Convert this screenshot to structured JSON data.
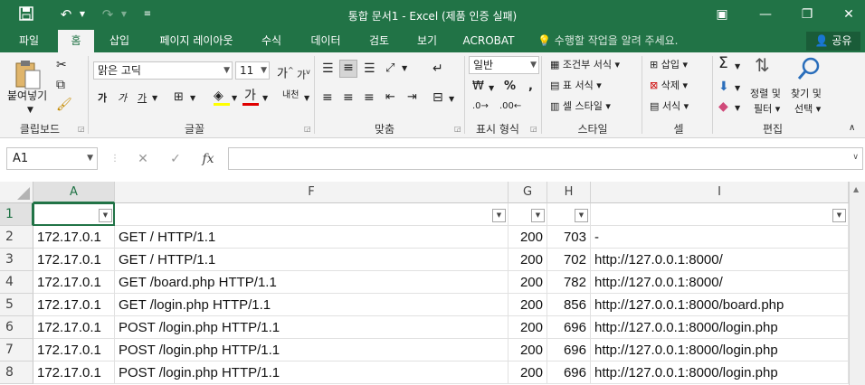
{
  "titlebar": {
    "title": "통합 문서1 - Excel (제품 인증 실패)",
    "icons": [
      "save-icon",
      "undo-icon",
      "redo-icon",
      "customize-icon"
    ]
  },
  "tabs": [
    "파일",
    "홈",
    "삽입",
    "페이지 레이아웃",
    "수식",
    "데이터",
    "검토",
    "보기",
    "ACROBAT"
  ],
  "tellme": "수행할 작업을 알려 주세요.",
  "share": "공유",
  "ribbon": {
    "clipboard": {
      "paste": "붙여넣기",
      "label": "클립보드"
    },
    "font": {
      "name": "맑은 고딕",
      "size": "11",
      "bold": "가",
      "italic": "가",
      "underline": "가",
      "fontcolor": "가",
      "phonetic": "내천",
      "grow": "가",
      "shrink": "가",
      "label": "글꼴"
    },
    "alignment": {
      "label": "맞춤"
    },
    "number": {
      "format": "일반",
      "label": "표시 형식"
    },
    "styles": {
      "conditional": "조건부 서식",
      "table": "표 서식",
      "cell": "셀 스타일",
      "label": "스타일"
    },
    "cells": {
      "insert": "삽입",
      "delete": "삭제",
      "format": "서식",
      "label": "셀"
    },
    "editing": {
      "sort1": "정렬 및",
      "sort2": "필터",
      "find1": "찾기 및",
      "find2": "선택",
      "label": "편집"
    }
  },
  "formula": {
    "namebox": "A1",
    "fx": "fx",
    "content": ""
  },
  "columns": [
    {
      "key": "A",
      "label": "A"
    },
    {
      "key": "F",
      "label": "F"
    },
    {
      "key": "G",
      "label": "G"
    },
    {
      "key": "H",
      "label": "H"
    },
    {
      "key": "I",
      "label": "I"
    }
  ],
  "rows": [
    {
      "num": "1",
      "a": "",
      "f": "",
      "g": "",
      "h": "",
      "i": ""
    },
    {
      "num": "2",
      "a": "172.17.0.1",
      "f": "GET / HTTP/1.1",
      "g": "200",
      "h": "703",
      "i": "-"
    },
    {
      "num": "3",
      "a": "172.17.0.1",
      "f": "GET / HTTP/1.1",
      "g": "200",
      "h": "702",
      "i": "http://127.0.0.1:8000/"
    },
    {
      "num": "4",
      "a": "172.17.0.1",
      "f": "GET /board.php HTTP/1.1",
      "g": "200",
      "h": "782",
      "i": "http://127.0.0.1:8000/"
    },
    {
      "num": "5",
      "a": "172.17.0.1",
      "f": "GET /login.php HTTP/1.1",
      "g": "200",
      "h": "856",
      "i": "http://127.0.0.1:8000/board.php"
    },
    {
      "num": "6",
      "a": "172.17.0.1",
      "f": "POST /login.php HTTP/1.1",
      "g": "200",
      "h": "696",
      "i": "http://127.0.0.1:8000/login.php"
    },
    {
      "num": "7",
      "a": "172.17.0.1",
      "f": "POST /login.php HTTP/1.1",
      "g": "200",
      "h": "696",
      "i": "http://127.0.0.1:8000/login.php"
    },
    {
      "num": "8",
      "a": "172.17.0.1",
      "f": "POST /login.php HTTP/1.1",
      "g": "200",
      "h": "696",
      "i": "http://127.0.0.1:8000/login.php"
    }
  ],
  "colors": {
    "accent": "#217346",
    "ribbon": "#f3f3f3"
  }
}
